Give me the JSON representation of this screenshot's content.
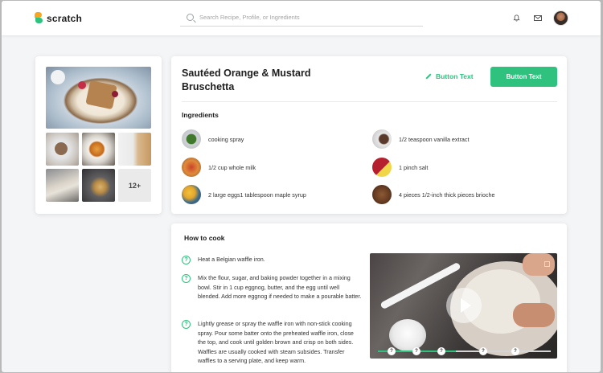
{
  "app": {
    "name": "scratch"
  },
  "search": {
    "placeholder": "Search Recipe, Profile, or Ingredients"
  },
  "gallery": {
    "more_count": "12+"
  },
  "recipe": {
    "title": "Sautéed Orange & Mustard Bruschetta",
    "secondary_button": "Button Text",
    "primary_button": "Button Text"
  },
  "ingredients": {
    "title": "Ingredients",
    "items": [
      {
        "label": "cooking spray",
        "color": "#3f7a2c"
      },
      {
        "label": "1/2 cup whole milk",
        "color": "#c9442b"
      },
      {
        "label": "2 large eggs1 tablespoon maple syrup",
        "color": "#e2a52d"
      },
      {
        "label": "1/2 teaspoon vanilla extract",
        "color": "#5a3a2a"
      },
      {
        "label": "1 pinch salt",
        "color": "#b51f2e"
      },
      {
        "label": "4 pieces 1/2-inch thick pieces brioche",
        "color": "#6b3f24"
      }
    ]
  },
  "how_to": {
    "title": "How to cook",
    "steps": [
      "Heat a Belgian waffle iron.",
      "Mix the flour, sugar, and baking powder together in a mixing bowl. Stir in 1 cup eggnog, butter, and the egg until well blended. Add more eggnog if needed to make a pourable batter.",
      "Lightly grease or spray the waffle iron with non-stick cooking spray. Pour some batter onto the preheated waffle iron, close the top, and cook until golden brown and crisp on both sides. Waffles are usually cooked with steam subsides. Transfer waffles to a serving plate, and keep warm."
    ],
    "check_glyph": "?"
  },
  "video": {
    "progress_percent": 45,
    "markers": [
      "?",
      "?",
      "?",
      "?",
      "?"
    ]
  },
  "colors": {
    "accent": "#2ec27e",
    "background": "#f4f5f7"
  }
}
